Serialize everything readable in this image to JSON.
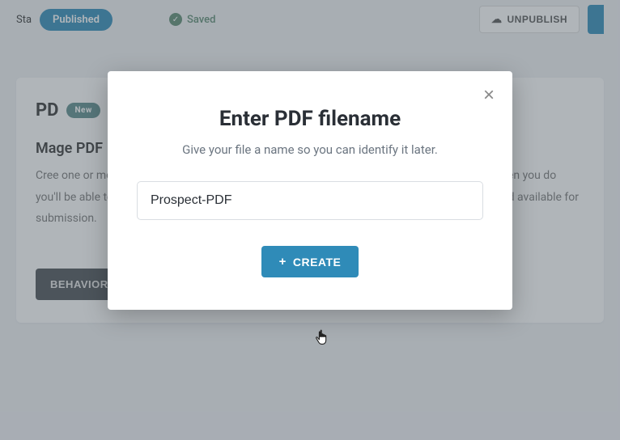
{
  "topbar": {
    "status_label": "Sta",
    "published_badge": "Published",
    "saved_text": "Saved",
    "unpublish_label": "UNPUBLISH"
  },
  "card": {
    "title_stub": "PD",
    "new_badge": "New",
    "section_title": "Mage PDF",
    "description": "Cree one or more PDFs templates that will be autopopulated and available for submission. When you do you'll be able to configure templates that map to your form fields so they are autopopulated and available for submission."
  },
  "behavior_button": "BEHAVIOR",
  "modal": {
    "title": "Enter PDF filename",
    "subtitle": "Give your file a name so you can identify it later.",
    "input_value": "Prospect-PDF",
    "create_label": "CREATE"
  }
}
